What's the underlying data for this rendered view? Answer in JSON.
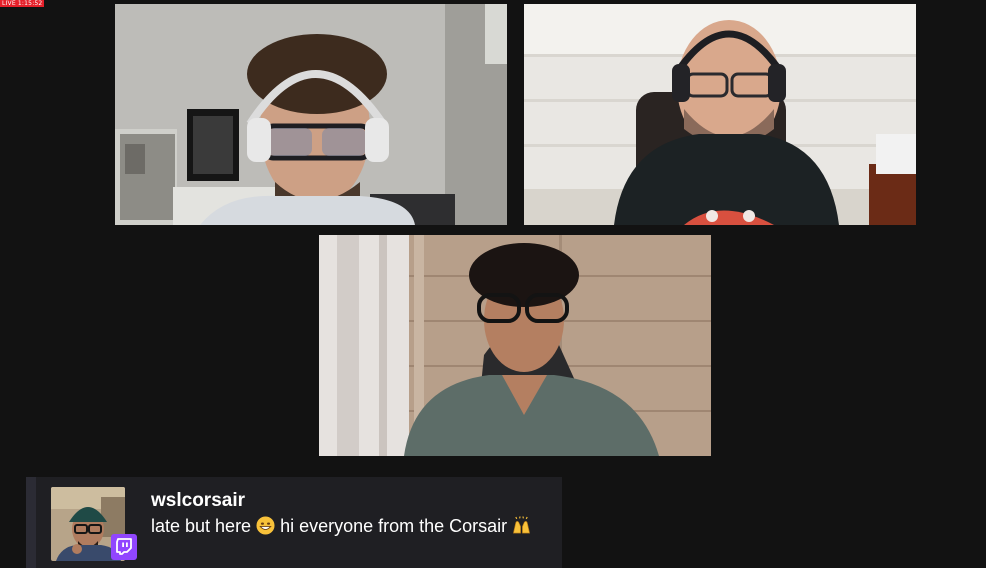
{
  "stream": {
    "live_badge": "LIVE 1:15:52"
  },
  "tiles": [
    {
      "participant": "video-tile-1"
    },
    {
      "participant": "video-tile-2"
    },
    {
      "participant": "video-tile-3"
    }
  ],
  "chat": {
    "username": "wslcorsair",
    "message_part1": "late but here ",
    "message_part2": " hi everyone from the Corsair ",
    "emoji_1": "grinning-face-icon",
    "emoji_2": "raising-hands-icon",
    "platform_icon": "twitch-icon"
  },
  "colors": {
    "background": "#121212",
    "chat_card": "#1f1f23",
    "live_red": "#e5202a",
    "twitch_purple": "#9146ff"
  }
}
